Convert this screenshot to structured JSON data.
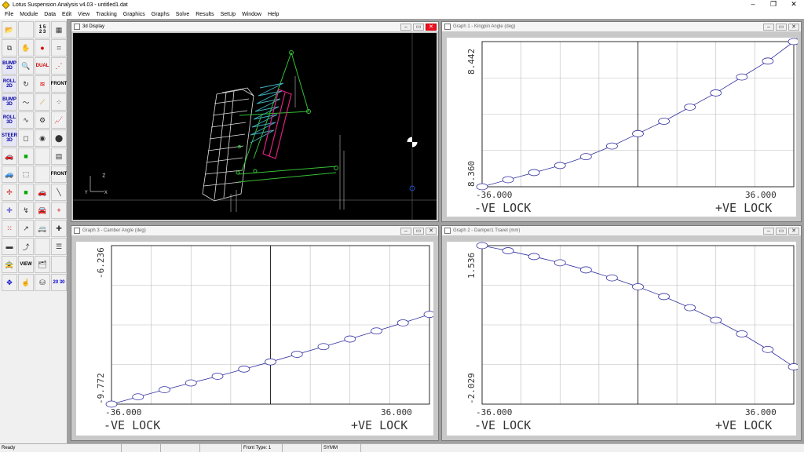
{
  "app": {
    "title": "Lotus Suspension Analysis v4.03 - untitled1.dat",
    "controls": {
      "minimize": "–",
      "maximize": "❐",
      "close": "✕"
    }
  },
  "menu": [
    "File",
    "Module",
    "Data",
    "Edit",
    "View",
    "Tracking",
    "Graphics",
    "Graphs",
    "Solve",
    "Results",
    "SetUp",
    "Window",
    "Help"
  ],
  "toolbar": {
    "labels": {
      "bump2d": "BUMP 2D",
      "roll2d": "ROLL 2D",
      "bump3d": "BUMP 3D",
      "roll3d": "ROLL 3D",
      "steer3d": "STEER 3D",
      "front": "FRONT",
      "view": "VIEW",
      "view2030": "20 30",
      "dual": "DUAL",
      "front2": "FRONT"
    }
  },
  "windows": {
    "display3d": {
      "title": "3d Display",
      "axis_z": "Z",
      "axis_y": "Y",
      "axis_x": "X"
    },
    "graph1": {
      "title": "Graph 1 - Kingpin Angle (deg)",
      "chart_data": {
        "type": "line",
        "x": [
          -36,
          -30,
          -24,
          -18,
          -12,
          -6,
          0,
          6,
          12,
          18,
          24,
          30,
          36
        ],
        "y": [
          8.36,
          8.364,
          8.368,
          8.372,
          8.377,
          8.383,
          8.39,
          8.397,
          8.405,
          8.413,
          8.422,
          8.431,
          8.442
        ],
        "xlim": [
          -36,
          36
        ],
        "ylim": [
          8.36,
          8.442
        ],
        "xtick_left": "-36.000",
        "xtick_right": "36.000",
        "ytick_top": "8.442",
        "ytick_bottom": "8.360",
        "xlabel_left": "-VE LOCK",
        "xlabel_right": "+VE LOCK"
      }
    },
    "graph3": {
      "title": "Graph 3 - Camber Angle (deg)",
      "chart_data": {
        "type": "line",
        "x": [
          -36,
          -30,
          -24,
          -18,
          -12,
          -6,
          0,
          6,
          12,
          18,
          24,
          30,
          36
        ],
        "y": [
          -9.772,
          -9.61,
          -9.45,
          -9.3,
          -9.15,
          -8.99,
          -8.83,
          -8.66,
          -8.49,
          -8.32,
          -8.14,
          -7.96,
          -7.77
        ],
        "xlim": [
          -36,
          36
        ],
        "ylim": [
          -9.772,
          -6.236
        ],
        "xtick_left": "-36.000",
        "xtick_right": "36.000",
        "ytick_top": "-6.236",
        "ytick_bottom": "-9.772",
        "xlabel_left": "-VE LOCK",
        "xlabel_right": "+VE LOCK"
      }
    },
    "graph2": {
      "title": "Graph 2 - Damper1 Travel (mm)",
      "chart_data": {
        "type": "line",
        "x": [
          -36,
          -30,
          -24,
          -18,
          -12,
          -6,
          0,
          6,
          12,
          18,
          24,
          30,
          36
        ],
        "y": [
          1.536,
          1.42,
          1.29,
          1.15,
          0.99,
          0.81,
          0.61,
          0.39,
          0.14,
          -0.14,
          -0.45,
          -0.8,
          -1.19
        ],
        "xlim": [
          -36,
          36
        ],
        "ylim": [
          -2.029,
          1.536
        ],
        "xtick_left": "-36.000",
        "xtick_right": "36.000",
        "ytick_top": "1.536",
        "ytick_bottom": "-2.029",
        "xlabel_left": "-VE LOCK",
        "xlabel_right": "+VE LOCK"
      }
    }
  },
  "status": {
    "ready": "Ready",
    "front_type": "Front Type: 1",
    "symm": "SYMM"
  }
}
